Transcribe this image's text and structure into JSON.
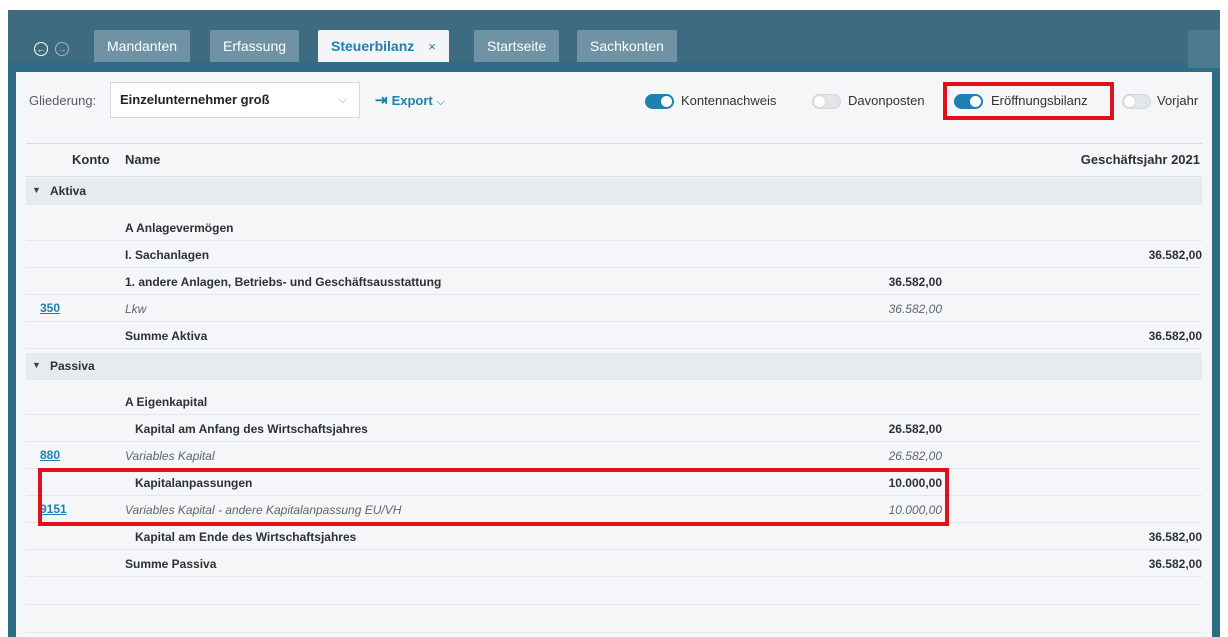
{
  "tabs": [
    {
      "label": "Mandanten"
    },
    {
      "label": "Erfassung"
    },
    {
      "label": "Steuerbilanz",
      "close": "×"
    },
    {
      "label": "Startseite"
    },
    {
      "label": "Sachkonten"
    }
  ],
  "nav": {
    "back_icon": "arrow-left-circle-icon",
    "forward_icon": "arrow-right-circle-icon",
    "back_glyph": "←",
    "forward_glyph": "→"
  },
  "toolbar": {
    "gliederung_label": "Gliederung:",
    "gliederung_value": "Einzelunternehmer groß",
    "select_caret": "⌵",
    "export_label": "Export",
    "export_caret": "⌵",
    "export_icon_glyph": "⇥",
    "toggles": [
      {
        "label": "Kontennachweis",
        "on": true
      },
      {
        "label": "Davonposten",
        "on": false
      },
      {
        "label": "Eröffnungsbilanz",
        "on": true
      },
      {
        "label": "Vorjahr",
        "on": false
      }
    ]
  },
  "table": {
    "headers": {
      "konto": "Konto",
      "name": "Name",
      "year": "Geschäftsjahr 2021"
    },
    "rows": [
      {
        "type": "group",
        "caret": "▼",
        "label": "Aktiva"
      },
      {
        "type": "bold",
        "indent": 0,
        "name": "A Anlagevermögen",
        "amt1": "",
        "amt2": ""
      },
      {
        "type": "bold",
        "indent": 0,
        "name": "I. Sachanlagen",
        "amt1": "",
        "amt2": "36.582,00"
      },
      {
        "type": "bold",
        "indent": 0,
        "name": "1. andere Anlagen, Betriebs- und Geschäftsausstattung",
        "amt1": "36.582,00",
        "amt2": ""
      },
      {
        "type": "italic",
        "konto": "350",
        "name": "Lkw",
        "amt1": "36.582,00",
        "amt2": ""
      },
      {
        "type": "bold",
        "indent": 0,
        "name": "Summe Aktiva",
        "amt1": "",
        "amt2": "36.582,00"
      },
      {
        "type": "group",
        "caret": "▼",
        "label": "Passiva"
      },
      {
        "type": "bold",
        "indent": 0,
        "name": "A Eigenkapital",
        "amt1": "",
        "amt2": ""
      },
      {
        "type": "bold",
        "indent": 1,
        "name": "Kapital am Anfang des Wirtschaftsjahres",
        "amt1": "26.582,00",
        "amt2": ""
      },
      {
        "type": "italic",
        "konto": "880",
        "name": "Variables Kapital",
        "amt1": "26.582,00",
        "amt2": ""
      },
      {
        "type": "bold",
        "indent": 1,
        "name": "Kapitalanpassungen",
        "amt1": "10.000,00",
        "amt2": ""
      },
      {
        "type": "italic",
        "konto": "9151",
        "name": "Variables Kapital - andere Kapitalanpassung EU/VH",
        "amt1": "10.000,00",
        "amt2": ""
      },
      {
        "type": "bold",
        "indent": 1,
        "name": "Kapital am Ende des Wirtschaftsjahres",
        "amt1": "",
        "amt2": "36.582,00"
      },
      {
        "type": "bold",
        "indent": 0,
        "name": "Summe Passiva",
        "amt1": "",
        "amt2": "36.582,00"
      }
    ]
  },
  "colors": {
    "accent": "#1e7fb0",
    "highlight": "#e01019",
    "frame": "#2f6d86"
  }
}
